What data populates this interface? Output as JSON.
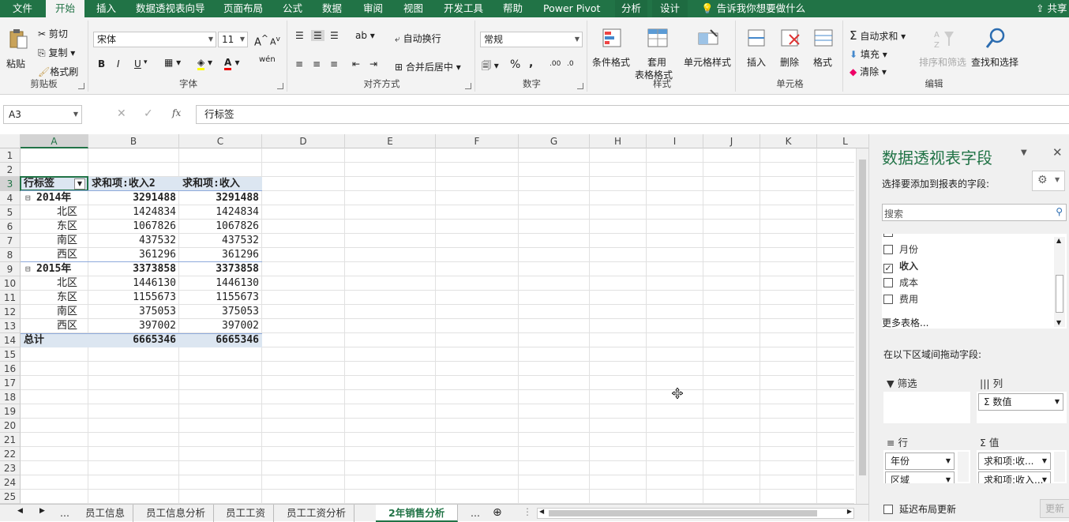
{
  "ribbon_tabs": [
    {
      "label": "文件"
    },
    {
      "label": "开始"
    },
    {
      "label": "插入"
    },
    {
      "label": "数据透视表向导"
    },
    {
      "label": "页面布局"
    },
    {
      "label": "公式"
    },
    {
      "label": "数据"
    },
    {
      "label": "审阅"
    },
    {
      "label": "视图"
    },
    {
      "label": "开发工具"
    },
    {
      "label": "帮助"
    },
    {
      "label": "Power Pivot"
    },
    {
      "label": "分析"
    },
    {
      "label": "设计"
    }
  ],
  "tell_me": "告诉我你想要做什么",
  "share": "共享",
  "clipboard": {
    "paste": "粘贴",
    "cut": "剪切",
    "copy": "复制",
    "format_painter": "格式刷",
    "label": "剪贴板"
  },
  "font": {
    "name": "宋体",
    "size": "11",
    "grow": "A",
    "shrink": "A",
    "bold": "B",
    "italic": "I",
    "underline": "U",
    "phonetic": "wén",
    "label": "字体"
  },
  "alignment": {
    "wrap": "自动换行",
    "merge": "合并后居中",
    "label": "对齐方式"
  },
  "number": {
    "format": "常规",
    "percent": "%",
    "comma": ",",
    "label": "数字"
  },
  "styles": {
    "conditional": "条件格式",
    "table1": "套用",
    "table2": "表格格式",
    "cell_styles": "单元格样式",
    "label": "样式"
  },
  "cells": {
    "insert": "插入",
    "delete": "删除",
    "format": "格式",
    "label": "单元格"
  },
  "editing": {
    "autosum": "自动求和",
    "fill": "填充",
    "clear": "清除",
    "sort": "排序和筛选",
    "find": "查找和选择",
    "label": "编辑"
  },
  "name_box": "A3",
  "formula": "行标签",
  "columns": [
    "A",
    "B",
    "C",
    "D",
    "E",
    "F",
    "G",
    "H",
    "I",
    "J",
    "K",
    "L"
  ],
  "rows": [
    "1",
    "2",
    "3",
    "4",
    "5",
    "6",
    "7",
    "8",
    "9",
    "10",
    "11",
    "12",
    "13",
    "14",
    "15",
    "16",
    "17",
    "18",
    "19",
    "20",
    "21",
    "22",
    "23",
    "24",
    "25"
  ],
  "pivot": {
    "header": [
      "行标签",
      "求和项:收入2",
      "求和项:收入"
    ],
    "body": [
      {
        "label": "2014年",
        "b": "3291488",
        "c": "3291488",
        "type": "year",
        "toggle": "⊟"
      },
      {
        "label": "北区",
        "b": "1424834",
        "c": "1424834",
        "type": "item"
      },
      {
        "label": "东区",
        "b": "1067826",
        "c": "1067826",
        "type": "item"
      },
      {
        "label": "南区",
        "b": "437532",
        "c": "437532",
        "type": "item"
      },
      {
        "label": "西区",
        "b": "361296",
        "c": "361296",
        "type": "item"
      },
      {
        "label": "2015年",
        "b": "3373858",
        "c": "3373858",
        "type": "year",
        "toggle": "⊟"
      },
      {
        "label": "北区",
        "b": "1446130",
        "c": "1446130",
        "type": "item"
      },
      {
        "label": "东区",
        "b": "1155673",
        "c": "1155673",
        "type": "item"
      },
      {
        "label": "南区",
        "b": "375053",
        "c": "375053",
        "type": "item"
      },
      {
        "label": "西区",
        "b": "397002",
        "c": "397002",
        "type": "item"
      },
      {
        "label": "总计",
        "b": "6665346",
        "c": "6665346",
        "type": "total"
      }
    ]
  },
  "sheet_tabs": [
    {
      "label": "..."
    },
    {
      "label": "员工信息"
    },
    {
      "label": "员工信息分析"
    },
    {
      "label": "员工工资"
    },
    {
      "label": "员工工资分析"
    },
    {
      "label": "2年销售分析"
    },
    {
      "label": "..."
    }
  ],
  "pane": {
    "title": "数据透视表字段",
    "subtitle": "选择要添加到报表的字段:",
    "search_placeholder": "搜索",
    "fields": [
      {
        "label": "月份",
        "checked": false
      },
      {
        "label": "收入",
        "checked": true
      },
      {
        "label": "成本",
        "checked": false
      },
      {
        "label": "费用",
        "checked": false
      }
    ],
    "more_tables": "更多表格...",
    "drag_hint": "在以下区域间拖动字段:",
    "filter_label": "筛选",
    "columns_label": "列",
    "rows_label": "行",
    "values_label": "值",
    "columns_items": [
      "Σ 数值"
    ],
    "rows_items": [
      "年份",
      "区域"
    ],
    "values_items": [
      "求和项:收...",
      "求和项:收入..."
    ],
    "defer": "延迟布局更新",
    "update": "更新"
  },
  "colors": {
    "accent": "#217346",
    "pivot_header_bg": "#dce6f1"
  }
}
